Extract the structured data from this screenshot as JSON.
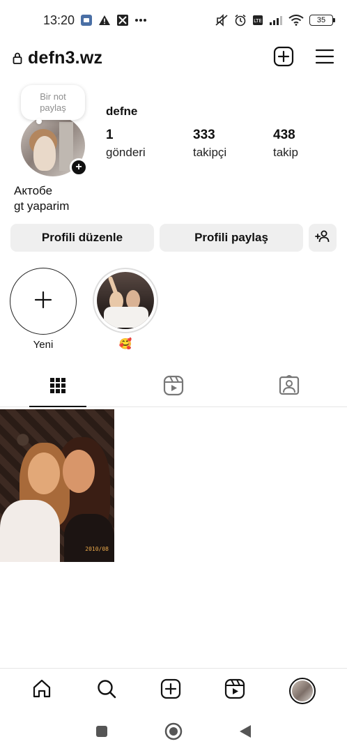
{
  "status_bar": {
    "time": "13:20",
    "battery": "35"
  },
  "header": {
    "username": "defn3.wz"
  },
  "profile": {
    "note_text": "Bir not paylaş",
    "display_name": "defne",
    "stats": {
      "posts_count": "1",
      "posts_label": "gönderi",
      "followers_count": "333",
      "followers_label": "takipçi",
      "following_count": "438",
      "following_label": "takip"
    },
    "bio_lines": [
      "Актобе",
      "gt yaparim"
    ]
  },
  "buttons": {
    "edit_profile": "Profili düzenle",
    "share_profile": "Profili paylaş"
  },
  "highlights": {
    "new_label": "Yeni",
    "story_label": "🥰"
  },
  "post": {
    "date_stamp": "2010/08"
  },
  "colors": {
    "text": "#111111",
    "button_bg": "#efefef",
    "divider": "#e6e6e6",
    "muted": "#8e8e8e"
  }
}
